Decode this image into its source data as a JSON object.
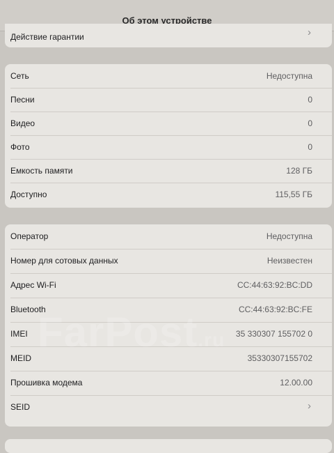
{
  "header": {
    "title": "Об этом устройстве"
  },
  "warranty": {
    "label": "Действие гарантии"
  },
  "stats": [
    {
      "label": "Сеть",
      "value": "Недоступна"
    },
    {
      "label": "Песни",
      "value": "0"
    },
    {
      "label": "Видео",
      "value": "0"
    },
    {
      "label": "Фото",
      "value": "0"
    },
    {
      "label": "Емкость памяти",
      "value": "128 ГБ"
    },
    {
      "label": "Доступно",
      "value": "115,55 ГБ"
    }
  ],
  "network": [
    {
      "label": "Оператор",
      "value": "Недоступна"
    },
    {
      "label": "Номер для сотовых данных",
      "value": "Неизвестен"
    },
    {
      "label": "Адрес Wi-Fi",
      "value": "CC:44:63:92:BC:DD"
    },
    {
      "label": "Bluetooth",
      "value": "CC:44:63:92:BC:FE"
    },
    {
      "label": "IMEI",
      "value": "35 330307 155702 0"
    },
    {
      "label": "MEID",
      "value": "35330307155702"
    },
    {
      "label": "Прошивка модема",
      "value": "12.00.00"
    },
    {
      "label": "SEID",
      "value": ""
    }
  ],
  "watermark": {
    "text": "FarPost",
    "suffix": ".ru"
  },
  "icons": {
    "chevron": "chevron-right-icon"
  }
}
